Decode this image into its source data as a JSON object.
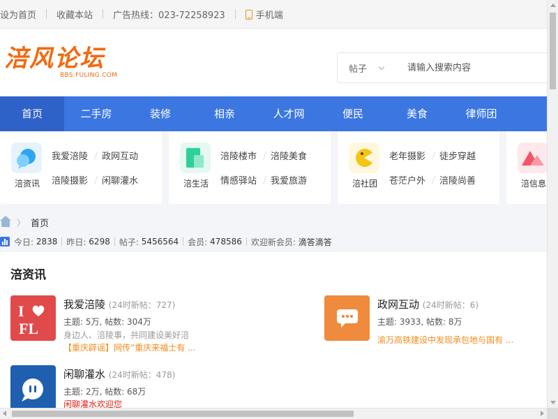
{
  "topbar": {
    "set_home": "设为首页",
    "bookmark": "收藏本站",
    "hotline": "广告热线：023-72258923",
    "mobile": "手机端"
  },
  "header": {
    "logo_text": "涪风论坛",
    "logo_sub": "BBS.FULING.COM",
    "search_type": "帖子",
    "search_placeholder": "请输入搜索内容"
  },
  "nav": {
    "items": [
      "首页",
      "二手房",
      "装修",
      "相亲",
      "人才网",
      "便民",
      "美食",
      "律师团"
    ],
    "active_index": 0
  },
  "categories": [
    {
      "name": "涪资讯",
      "icon": "chat-bubble-icon",
      "color": "#2da6f2",
      "links": [
        "我爱涪陵",
        "政网互动",
        "涪陵摄影",
        "闲聊灌水"
      ]
    },
    {
      "name": "涪生活",
      "icon": "document-icon",
      "color": "#2fcf9d",
      "links": [
        "涪陵楼市",
        "涪陵美食",
        "情感驿站",
        "我爱旅游"
      ]
    },
    {
      "name": "涪社团",
      "icon": "pacman-icon",
      "color": "#f5c515",
      "links": [
        "老年摄影",
        "徒步穿越",
        "苍茫户外",
        "涪陵尚善"
      ]
    },
    {
      "name": "涪信息",
      "icon": "mountain-icon",
      "color": "#f2556a",
      "links": []
    }
  ],
  "breadcrumb": {
    "home_label": "首页"
  },
  "stats": {
    "today_label": "今日:",
    "today": "2838",
    "yesterday_label": "昨日:",
    "yesterday": "6298",
    "posts_label": "帖子:",
    "posts": "5456564",
    "members_label": "会员:",
    "members": "478586",
    "welcome_label": "欢迎新会员:",
    "new_member": "滴答滴答"
  },
  "section": {
    "title": "涪资讯",
    "forums": [
      {
        "name": "我爱涪陵",
        "new_posts": "(24时新帖：727)",
        "stats": "主题: 5万, 帖数: 304万",
        "desc": "身边人、涪陵事，共同建设美好涪",
        "latest": "【重庆辟谣】网传“重庆来福士有 ...",
        "latest_color": "orange",
        "icon": "ifl-logo-icon",
        "color": "#e04a4a"
      },
      {
        "name": "政网互动",
        "new_posts": "(24时新帖：6)",
        "stats": "主题: 3933, 帖数: 8万",
        "desc": "",
        "latest": "渝万高铁建设中发现承包地与国有 ...",
        "latest_color": "orange",
        "icon": "message-bubble-icon",
        "color": "#f08a3c"
      },
      {
        "name": "闲聊灌水",
        "new_posts": "(24时新帖：478)",
        "stats": "主题: 2万, 帖数: 68万",
        "desc": "",
        "latest": "闲聊灌水欢迎您",
        "latest_color": "red",
        "icon": "voice-bubble-icon",
        "color": "#1e5fb0"
      }
    ]
  }
}
